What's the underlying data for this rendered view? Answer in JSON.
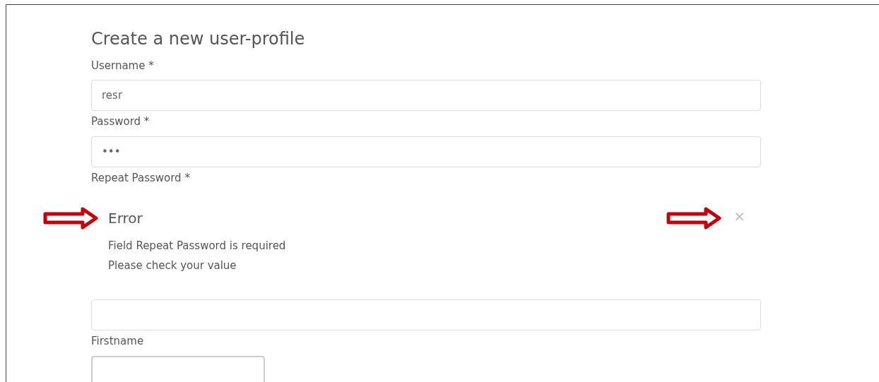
{
  "title": "Create a new user-profile",
  "fields": [
    {
      "label": "Username *",
      "value": "resr",
      "kind": "wide"
    },
    {
      "label": "Password *",
      "value": "•••",
      "kind": "wide"
    },
    {
      "label": "Repeat Password *",
      "kind": "wide",
      "error": {
        "heading": "Error",
        "lines": [
          "Field Repeat Password is required",
          "Please check your value"
        ],
        "close": "×"
      }
    },
    {
      "label": "Firstname",
      "kind": "narrow"
    }
  ]
}
